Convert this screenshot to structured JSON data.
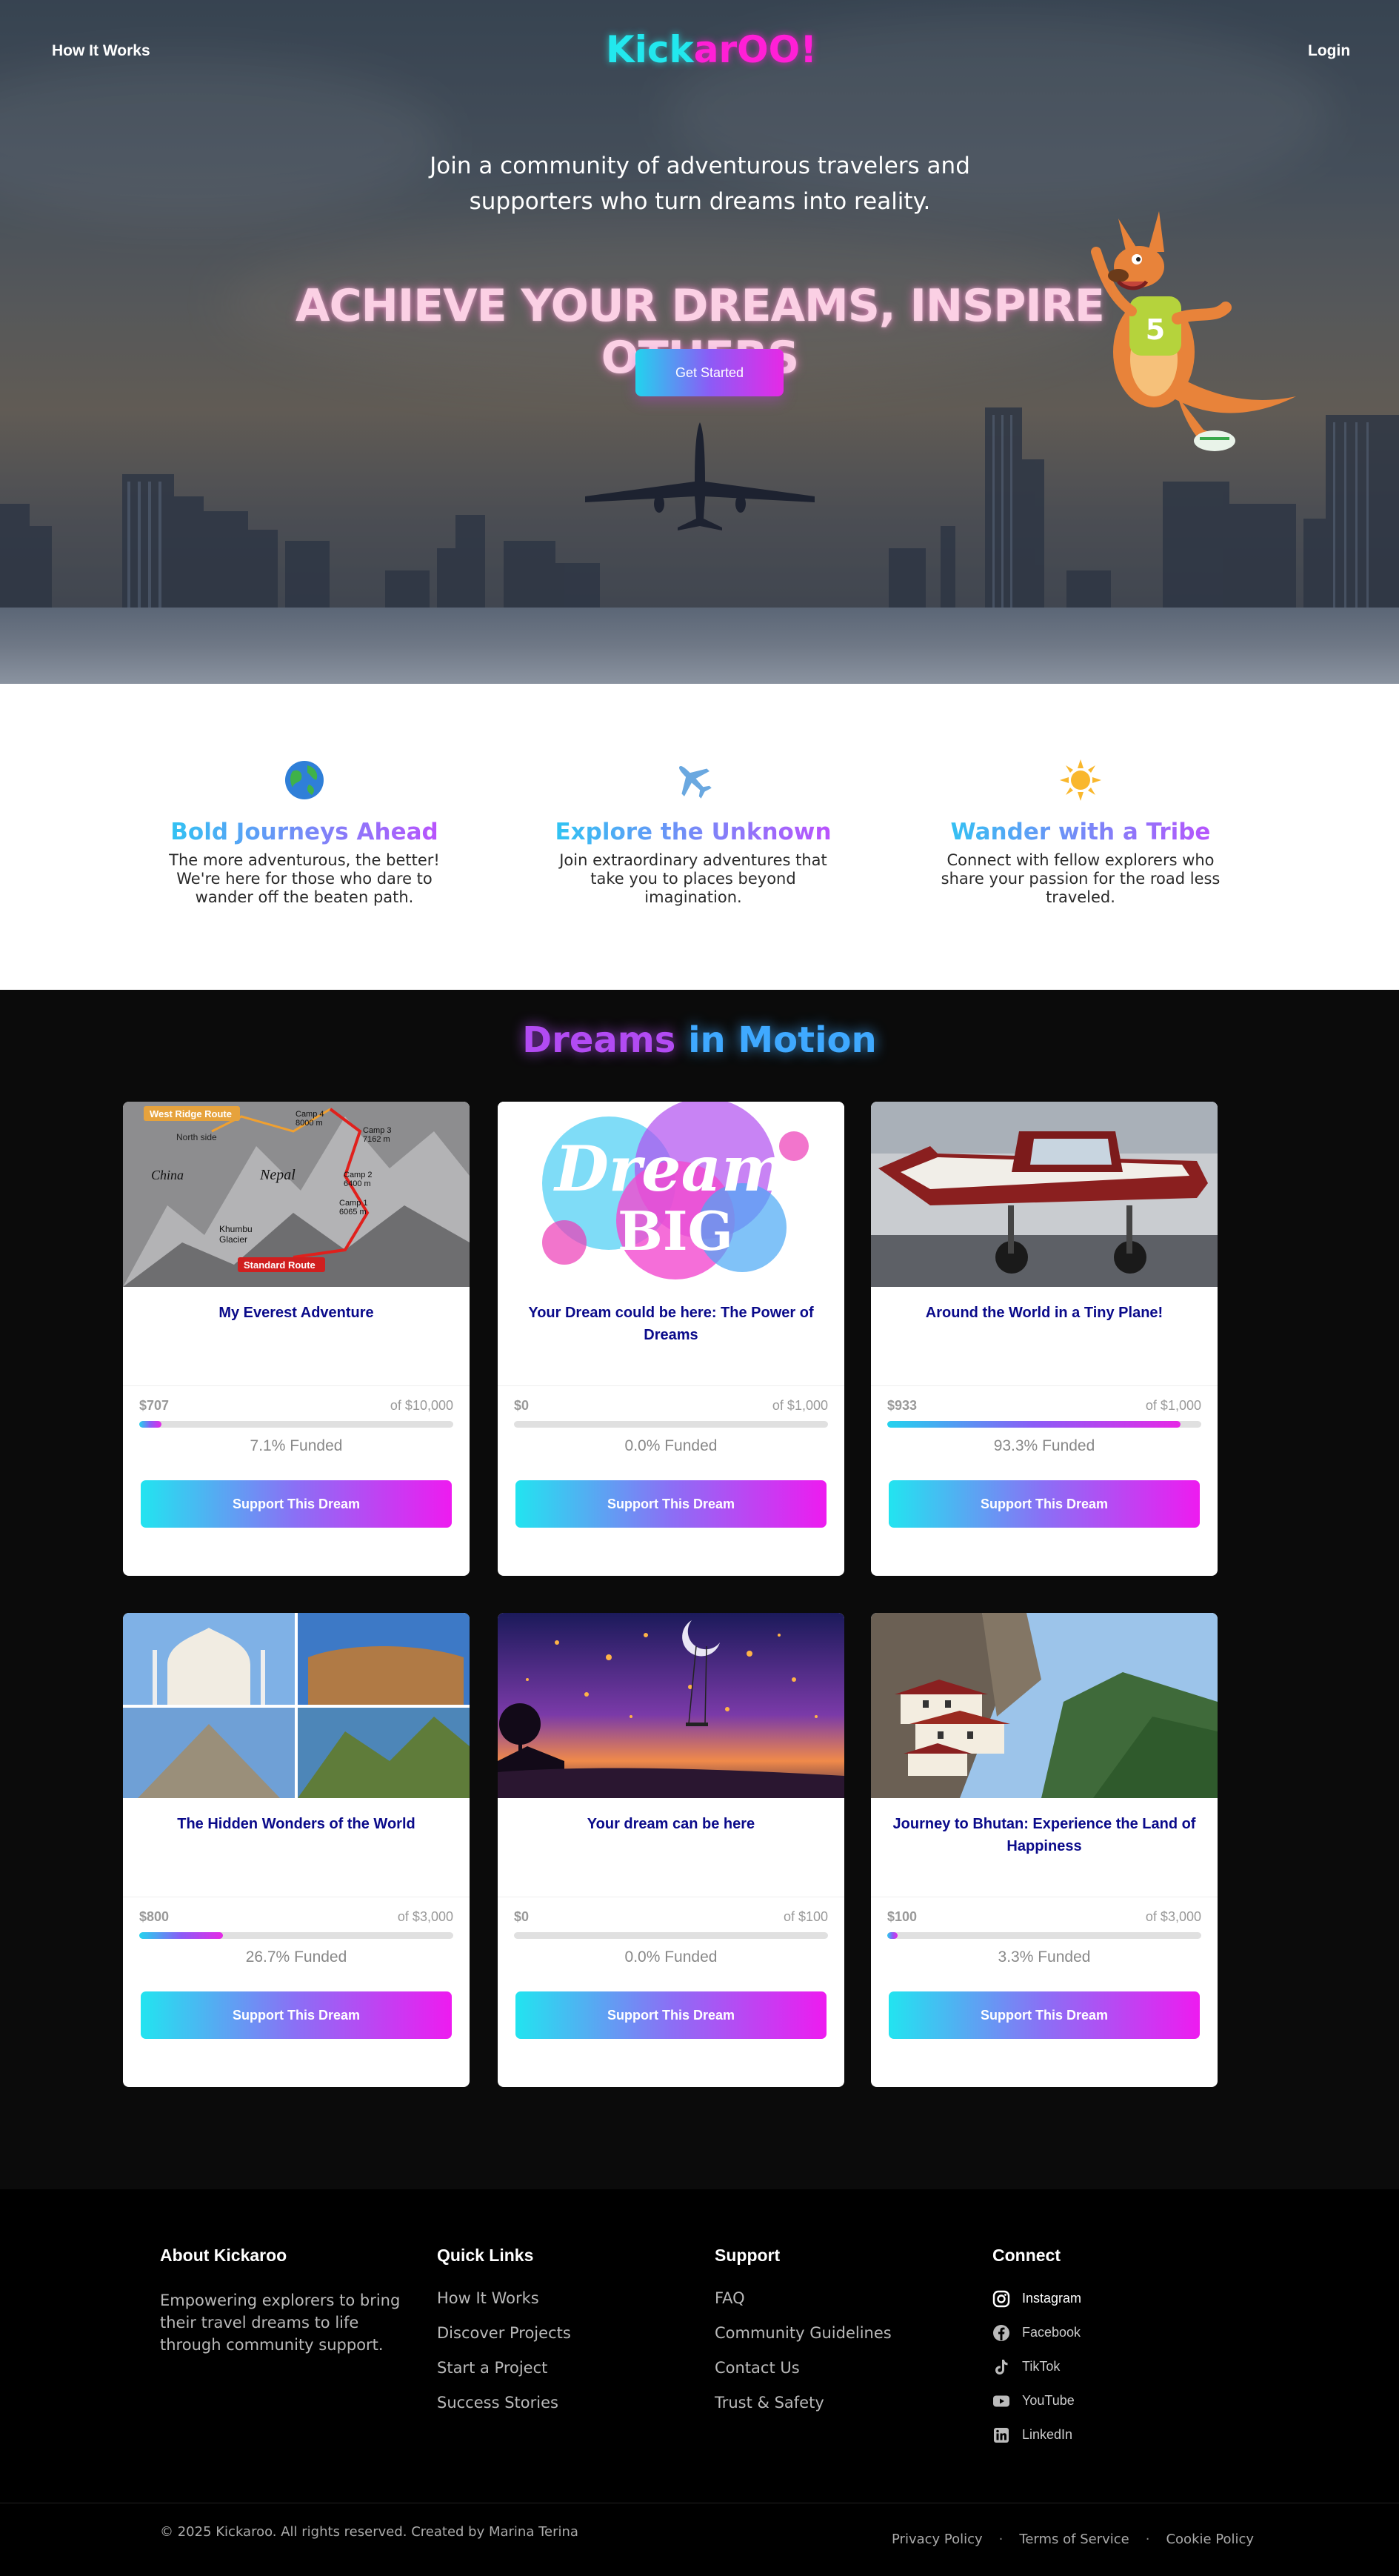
{
  "nav": {
    "how_it_works": "How It Works",
    "logo_part1": "Kick",
    "logo_part2": "arOO!",
    "login": "Login"
  },
  "hero": {
    "subtitle": "Join a community of adventurous travelers and supporters who turn dreams into reality.",
    "title": "ACHIEVE YOUR DREAMS, INSPIRE OTHERS",
    "cta": "Get Started"
  },
  "features": [
    {
      "icon": "globe-icon",
      "title": "Bold Journeys Ahead",
      "text": "The more adventurous, the better! We're here for those who dare to wander off the beaten path."
    },
    {
      "icon": "airplane-icon",
      "title": "Explore the Unknown",
      "text": "Join extraordinary adventures that take you to places beyond imagination."
    },
    {
      "icon": "sun-icon",
      "title": "Wander with a Tribe",
      "text": "Connect with fellow explorers who share your passion for the road less traveled."
    }
  ],
  "dreams": {
    "title_part1": "Dreams",
    "title_part2": "in Motion",
    "cards": [
      {
        "title": "My Everest Adventure",
        "raised": "$707",
        "goal": "of $10,000",
        "progress": 0.071,
        "funded": "7.1% Funded",
        "button": "Support This Dream",
        "map_labels": {
          "west_ridge": "West Ridge Route",
          "north_side": "North side",
          "china": "China",
          "nepal": "Nepal",
          "camp4": "Camp 4",
          "camp4_alt": "8000 m",
          "camp3": "Camp 3",
          "camp3_alt": "7162 m",
          "camp2": "Camp 2",
          "camp2_alt": "6400 m",
          "camp1": "Camp 1",
          "camp1_alt": "6065 m",
          "khumbu": "Khumbu",
          "glacier": "Glacier",
          "standard": "Standard Route"
        }
      },
      {
        "title": "Your Dream could be here: The Power of Dreams",
        "raised": "$0",
        "goal": "of $1,000",
        "progress": 0.0,
        "funded": "0.0% Funded",
        "button": "Support This Dream",
        "art_text_1": "Dream",
        "art_text_2": "BIG"
      },
      {
        "title": "Around the World in a Tiny Plane!",
        "raised": "$933",
        "goal": "of $1,000",
        "progress": 0.933,
        "funded": "93.3% Funded",
        "button": "Support This Dream"
      },
      {
        "title": "The Hidden Wonders of the World",
        "raised": "$800",
        "goal": "of $3,000",
        "progress": 0.267,
        "funded": "26.7% Funded",
        "button": "Support This Dream"
      },
      {
        "title": "Your dream can be here",
        "raised": "$0",
        "goal": "of $100",
        "progress": 0.0,
        "funded": "0.0% Funded",
        "button": "Support This Dream"
      },
      {
        "title": "Journey to Bhutan: Experience the Land of Happiness",
        "raised": "$100",
        "goal": "of $3,000",
        "progress": 0.033,
        "funded": "3.3% Funded",
        "button": "Support This Dream"
      }
    ]
  },
  "footer": {
    "about_title": "About Kickaroo",
    "about_text": "Empowering explorers to bring their travel dreams to life through community support.",
    "quick_title": "Quick Links",
    "quick_links": [
      "How It Works",
      "Discover Projects",
      "Start a Project",
      "Success Stories"
    ],
    "support_title": "Support",
    "support_links": [
      "FAQ",
      "Community Guidelines",
      "Contact Us",
      "Trust & Safety"
    ],
    "connect_title": "Connect",
    "social": [
      {
        "icon": "instagram-icon",
        "label": "Instagram"
      },
      {
        "icon": "facebook-icon",
        "label": "Facebook"
      },
      {
        "icon": "tiktok-icon",
        "label": "TikTok"
      },
      {
        "icon": "youtube-icon",
        "label": "YouTube"
      },
      {
        "icon": "linkedin-icon",
        "label": "LinkedIn"
      }
    ],
    "copyright": "© 2025 Kickaroo. All rights reserved. Created by Marina Terina",
    "legal": [
      "Privacy Policy",
      "Terms of Service",
      "Cookie Policy"
    ]
  },
  "colors": {
    "cyan": "#22e8ee",
    "magenta": "#ff1fd6",
    "purple": "#8b5cf6",
    "navy": "#0a0a8a"
  }
}
